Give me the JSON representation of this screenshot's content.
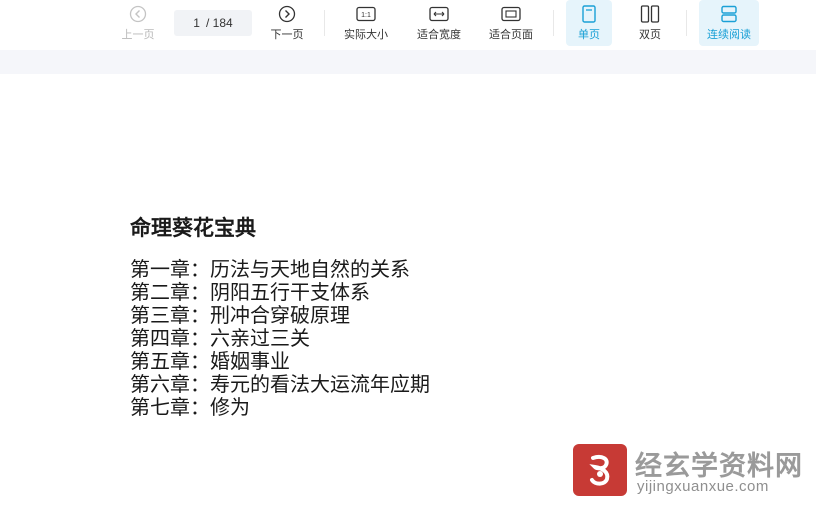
{
  "toolbar": {
    "prev_label": "上一页",
    "page_current": "1",
    "page_total": "/ 184",
    "next_label": "下一页",
    "actual_size_label": "实际大小",
    "fit_width_label": "适合宽度",
    "fit_page_label": "适合页面",
    "single_page_label": "单页",
    "double_page_label": "双页",
    "continuous_label": "连续阅读",
    "actual_size_icon_text": "1:1",
    "accent_color": "#1aa0d6"
  },
  "document": {
    "title": "命理葵花宝典",
    "chapters": [
      "第一章：历法与天地自然的关系",
      "第二章：阴阳五行干支体系",
      "第三章：刑冲合穿破原理",
      "第四章：六亲过三关",
      "第五章：婚姻事业",
      "第六章：寿元的看法大运流年应期",
      "第七章：修为"
    ]
  },
  "watermark": {
    "name_cn": "经玄学资料网",
    "domain": "yijingxuanxue.com",
    "brand_color": "#c73a35"
  }
}
